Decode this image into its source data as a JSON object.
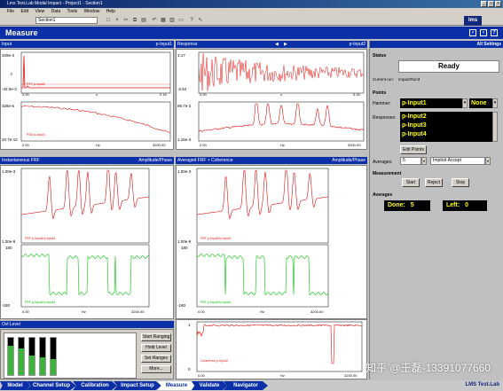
{
  "window": {
    "title": "Lms Test.Lab Modal Impact - Project1 - Section1",
    "menu": [
      "File",
      "Edit",
      "View",
      "Data",
      "Tools",
      "Window",
      "Help"
    ],
    "section_combo": "Section1",
    "logo": "lms"
  },
  "header": {
    "title": "Measure"
  },
  "panels": {
    "input": {
      "title": "Input",
      "channel": "p-Input1",
      "ytop": "329e-3",
      "ybottom": "-42.0e-3",
      "xleft": "0.00",
      "xright": "0.16",
      "xlabel": "s",
      "trace_label": "PTP p-Input1"
    },
    "input_spectrum": {
      "ytop": "328e-6",
      "ybottom": "20.7e-12",
      "xleft": "0.00",
      "xright": "3200.00",
      "xlabel": "Hz",
      "trace_label": "PSD p-Input1"
    },
    "response": {
      "title": "Response",
      "channel": "p-Input2",
      "ytop": "3.17",
      "ybottom": "-2.54",
      "xleft": "0.00",
      "xright": "0.16",
      "xlabel": "s"
    },
    "response_spectrum": {
      "ytop": "86.7e-3",
      "ybottom": "1.16e-3",
      "xleft": "0.00",
      "xright": "3200.00",
      "xlabel": "Hz"
    },
    "inst_frf": {
      "title": "Instantaneous FRF",
      "mode": "Amplitude/Phase",
      "ytop": "1.00e-3",
      "ybottom": "1.00e-9",
      "phase_top": "180",
      "phase_bottom": "-180",
      "xleft": "0.00",
      "xright": "3200.00",
      "xlabel": "Hz",
      "amp_label": "FRF p-Input2/p-Input1",
      "phase_label": "FRF p-Input2/p-Input1"
    },
    "avg_frf": {
      "title": "Averaged FRF + Coherence",
      "mode": "Amplitude/Phase",
      "ytop": "1.00e-3",
      "ybottom": "1.00e-9",
      "phase_top": "180",
      "phase_bottom": "-180",
      "xleft": "0.00",
      "xright": "3200.00",
      "xlabel": "Hz",
      "amp_label": "FRF p-Input2/p-Input1",
      "phase_label": "FRF p-Input2/p-Input1"
    },
    "coherence": {
      "ytop": "1",
      "ybottom": "0",
      "xleft": "0.00",
      "xright": "3200.00",
      "xlabel": "Hz",
      "trace_label": "Coherence p-Input2"
    },
    "ovl_level": {
      "title": "Ovl Level",
      "buttons": [
        "Start Ranging",
        "Hold Level",
        "Set Ranges",
        "More..."
      ],
      "levels": [
        0.78,
        0.71,
        0.52,
        0.48,
        0.42
      ]
    }
  },
  "side": {
    "title": "All Settings",
    "status_title": "Status",
    "status_value": "Ready",
    "current_run_label": "Current run:",
    "current_run": "ImpactRun3",
    "points_title": "Points",
    "hammer_label": "Hammer:",
    "hammer_value": "p-Input1",
    "hammer_dir": "None",
    "responses_label": "Responses:",
    "responses": [
      "p-Input2",
      "p-Input3",
      "p-Input4"
    ],
    "edit_points": "Edit Points",
    "averages_label": "Averages:",
    "averages_value": "5",
    "averaging_mode": "Implicit Accept",
    "measurement_title": "Measurement",
    "meas_buttons": [
      "Start",
      "Reject",
      "Stop"
    ],
    "averages_title": "Averages",
    "done_label": "Done:",
    "done_value": "5",
    "left_label": "Left:",
    "left_value": "0"
  },
  "nav": {
    "tabs": [
      "Model",
      "Channel Setup",
      "Calibration",
      "Impact Setup",
      "Measure",
      "Validate",
      "Navigator"
    ],
    "active": "Measure",
    "logo": "LMS Test.Lab"
  },
  "watermark": "知乎 @王磊-13391077660",
  "colors": {
    "accent": "#0a2fa6",
    "trace_red": "#e01010",
    "trace_green": "#00c000",
    "highlight": "#ffff00"
  }
}
